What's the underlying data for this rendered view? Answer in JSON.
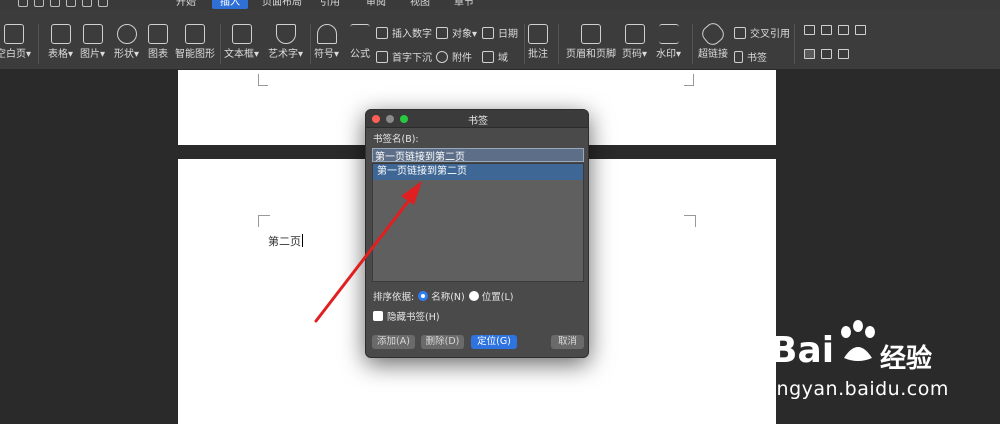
{
  "menu": {
    "tabs": [
      {
        "label": "开始",
        "active": false
      },
      {
        "label": "插入",
        "active": true
      },
      {
        "label": "页面布局",
        "active": false
      },
      {
        "label": "引用",
        "active": false
      },
      {
        "label": "审阅",
        "active": false
      },
      {
        "label": "视图",
        "active": false
      },
      {
        "label": "章节",
        "active": false
      }
    ]
  },
  "ribbon": {
    "tools": [
      {
        "label": "空白页▾",
        "icon": "blank-page-icon"
      },
      {
        "label": "表格▾",
        "icon": "table-icon"
      },
      {
        "label": "图片▾",
        "icon": "image-icon"
      },
      {
        "label": "形状▾",
        "icon": "shapes-icon"
      },
      {
        "label": "图表",
        "icon": "chart-icon"
      },
      {
        "label": "智能图形",
        "icon": "smart-art-icon"
      },
      {
        "label": "文本框▾",
        "icon": "textbox-icon"
      },
      {
        "label": "艺术字▾",
        "icon": "wordart-icon"
      },
      {
        "label": "符号▾",
        "icon": "omega-icon"
      },
      {
        "label": "公式",
        "icon": "pi-icon"
      },
      {
        "label": "批注",
        "icon": "comment-icon"
      },
      {
        "label": "页眉和页脚",
        "icon": "header-footer-icon"
      },
      {
        "label": "页码▾",
        "icon": "page-number-icon"
      },
      {
        "label": "水印▾",
        "icon": "watermark-icon"
      },
      {
        "label": "超链接",
        "icon": "link-icon"
      }
    ],
    "small_tools": [
      {
        "label": "插入数字",
        "icon": "insert-number-icon"
      },
      {
        "label": "首字下沉",
        "icon": "drop-cap-icon"
      },
      {
        "label": "对象▾",
        "icon": "object-icon"
      },
      {
        "label": "附件",
        "icon": "paperclip-icon"
      },
      {
        "label": "日期",
        "icon": "date-icon"
      },
      {
        "label": "域",
        "icon": "field-icon"
      },
      {
        "label": "交叉引用",
        "icon": "cross-reference-icon"
      },
      {
        "label": "书签",
        "icon": "bookmark-icon"
      }
    ]
  },
  "document": {
    "page2_text": "第二页"
  },
  "dialog": {
    "title": "书签",
    "name_label": "书签名(B):",
    "name_value": "第一页链接到第二页",
    "list_items": [
      "第一页链接到第二页"
    ],
    "sort_label": "排序依据:",
    "sort_by_name": "名称(N)",
    "sort_by_position": "位置(L)",
    "sort_selected": "name",
    "hide_label": "隐藏书签(H)",
    "buttons": {
      "add": "添加(A)",
      "delete": "删除(D)",
      "goto": "定位(G)",
      "cancel": "取消"
    },
    "traffic_colors": {
      "close": "#ff5f57",
      "minimize": "#febc2e",
      "zoom": "#28c840"
    }
  },
  "annotation": {
    "arrow_color": "#e02020"
  },
  "watermark": {
    "brand": "Bai",
    "brand_cn": "经验",
    "url": "jingyan.baidu.com"
  }
}
